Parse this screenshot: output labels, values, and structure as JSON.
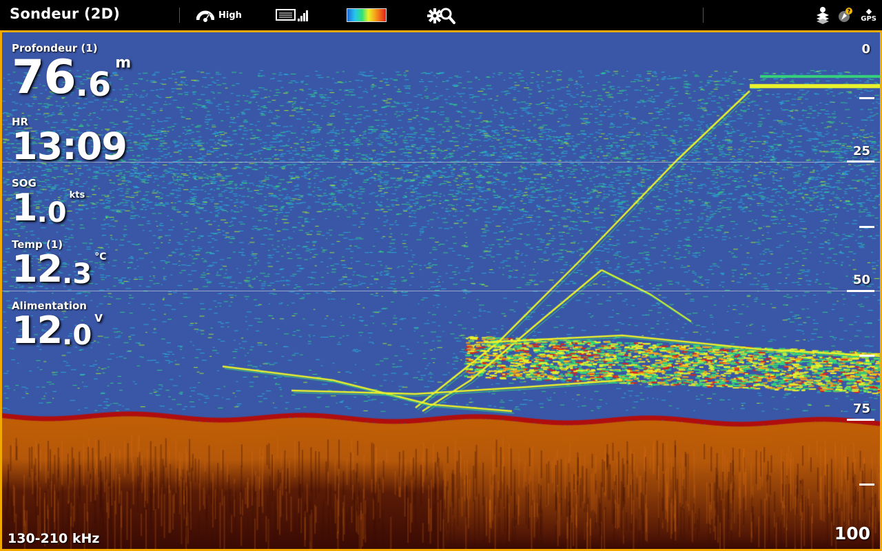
{
  "app": {
    "title": "Sondeur (2D)"
  },
  "toolbar": {
    "sensitivity_label": "High",
    "icons": [
      "sensitivity-icon",
      "chart-view-icon",
      "signal-bars-icon",
      "color-palette",
      "settings-zoom-icon"
    ],
    "palette_colors": [
      "#1e6ad8",
      "#26c6f0",
      "#2fe07a",
      "#e8f22a",
      "#f7a21a",
      "#e4201a"
    ]
  },
  "status": {
    "gps_label": "GPS",
    "icons": [
      "layers-icon",
      "alarm-icon",
      "gps-icon"
    ]
  },
  "readouts": {
    "depth": {
      "title": "Profondeur (1)",
      "int": "76",
      "dec": ".6",
      "unit": "m"
    },
    "time": {
      "title": "HR",
      "value": "13:09"
    },
    "sog": {
      "title": "SOG",
      "int": "1",
      "dec": ".0",
      "unit": "kts"
    },
    "temp": {
      "title": "Temp (1)",
      "int": "12",
      "dec": ".3",
      "unit": "°C"
    },
    "power": {
      "title": "Alimentation",
      "int": "12",
      "dec": ".0",
      "unit": "V"
    }
  },
  "scale": {
    "labels": [
      "0",
      "25",
      "50",
      "75"
    ],
    "bottom": "100"
  },
  "footer": {
    "frequency": "130-210 kHz"
  },
  "colors": {
    "frame_border": "#f2a900",
    "water": "#3a56a6",
    "bottom": "#c15f06",
    "bottom_edge": "#b00e0e"
  }
}
